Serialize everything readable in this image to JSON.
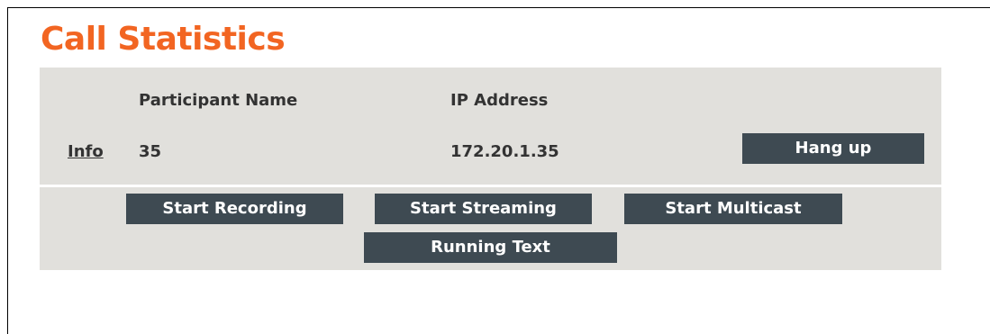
{
  "title": "Call Statistics",
  "table": {
    "headers": {
      "participant_name": "Participant Name",
      "ip_address": "IP Address"
    },
    "rows": [
      {
        "info_link": "Info",
        "participant_name": "35",
        "ip_address": "172.20.1.35",
        "hangup_label": "Hang up"
      }
    ]
  },
  "actions": {
    "start_recording": "Start Recording",
    "start_streaming": "Start Streaming",
    "start_multicast": "Start Multicast",
    "running_text": "Running Text"
  },
  "colors": {
    "title": "#f26522",
    "panel_bg": "#e1e0dc",
    "button_bg": "#3e4a52",
    "button_text": "#ffffff",
    "text": "#333333"
  }
}
